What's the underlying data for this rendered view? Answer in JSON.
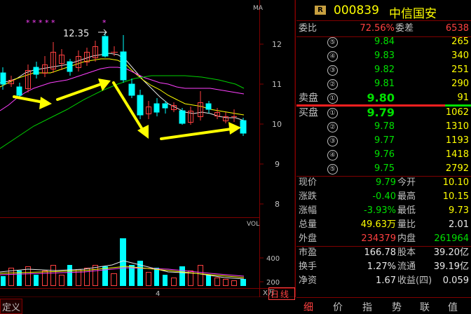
{
  "chart": {
    "ma_label": "MA",
    "high_price": "12.35",
    "price_ticks": [
      "12",
      "11",
      "10",
      "9",
      "8"
    ],
    "vol_label": "VOL",
    "vol_ticks": [
      "400",
      "200"
    ],
    "vol_unit": "X万",
    "period_label": "日线",
    "date_label": "4",
    "bottom_left_label": "定义",
    "star_marks": "* * * * *",
    "star_single": "*"
  },
  "quote": {
    "badge": "R",
    "code": "000839",
    "name": "中信国安",
    "weibi_label": "委比",
    "weibi_value": "72.56%",
    "weicha_label": "委差",
    "weicha_value": "6538",
    "sell_label": "卖盘",
    "buy_label": "买盘",
    "sell": [
      {
        "no": "⑤",
        "price": "9.84",
        "vol": "265"
      },
      {
        "no": "④",
        "price": "9.83",
        "vol": "340"
      },
      {
        "no": "③",
        "price": "9.82",
        "vol": "251"
      },
      {
        "no": "②",
        "price": "9.81",
        "vol": "290"
      },
      {
        "no": "①",
        "price": "9.80",
        "vol": "91"
      }
    ],
    "buy": [
      {
        "no": "①",
        "price": "9.79",
        "vol": "1062"
      },
      {
        "no": "②",
        "price": "9.78",
        "vol": "1310"
      },
      {
        "no": "③",
        "price": "9.77",
        "vol": "1193"
      },
      {
        "no": "④",
        "price": "9.76",
        "vol": "1418"
      },
      {
        "no": "⑤",
        "price": "9.75",
        "vol": "2792"
      }
    ],
    "stats": [
      {
        "l1": "现价",
        "v1": "9.79",
        "l2": "今开",
        "v2": "10.10"
      },
      {
        "l1": "涨跌",
        "v1": "-0.40",
        "l2": "最高",
        "v2": "10.15"
      },
      {
        "l1": "涨幅",
        "v1": "-3.93%",
        "l2": "最低",
        "v2": "9.73"
      },
      {
        "l1": "总量",
        "v1": "49.63万",
        "l2": "量比",
        "v2": "2.01"
      },
      {
        "l1": "外盘",
        "v1": "234379",
        "l2": "内盘",
        "v2": "261964"
      },
      {
        "l1": "市盈",
        "v1": "166.78",
        "l2": "股本",
        "v2": "39.20亿"
      },
      {
        "l1": "换手",
        "v1": "1.27%",
        "l2": "流通",
        "v2": "39.19亿"
      },
      {
        "l1": "净资",
        "v1": "1.67",
        "l2": "收益(四)",
        "v2": "0.059"
      }
    ],
    "tabs": [
      "细",
      "价",
      "指",
      "势",
      "联",
      "值"
    ]
  },
  "colors": {
    "up": "#ff4040",
    "down": "#00ffff",
    "accent": "#ffff00",
    "grid": "#800000"
  }
}
